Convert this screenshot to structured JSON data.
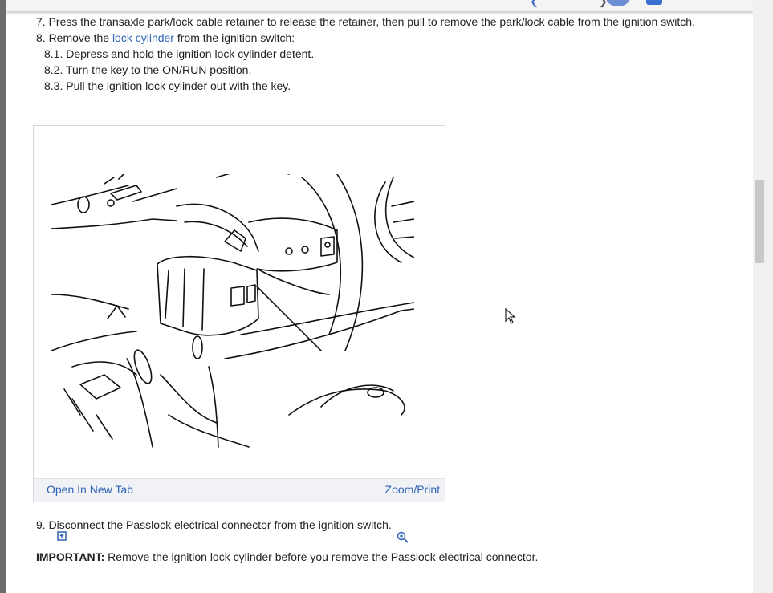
{
  "steps": {
    "s7": "7. Press the transaxle park/lock cable retainer to release the retainer, then pull to remove the park/lock cable from the ignition switch.",
    "s8_prefix": "8. Remove the ",
    "s8_link": "lock cylinder",
    "s8_suffix": " from the ignition switch:",
    "s8_1": "8.1. Depress and hold the ignition lock cylinder detent.",
    "s8_2": "8.2. Turn the key to the ON/RUN position.",
    "s8_3": "8.3. Pull the ignition lock cylinder out with the key.",
    "s9": "9. Disconnect the Passlock electrical connector from the ignition switch.",
    "important_label": "IMPORTANT:",
    "important_text": " Remove the ignition lock cylinder before you remove the Passlock electrical connector."
  },
  "figure": {
    "open_tab_label": "Open In New Tab",
    "zoom_label": "Zoom/Print",
    "open_icon": "open-in-new-tab-icon",
    "zoom_icon": "zoom-icon"
  },
  "colors": {
    "link": "#2f64b7",
    "accent": "#3b6fd0"
  }
}
